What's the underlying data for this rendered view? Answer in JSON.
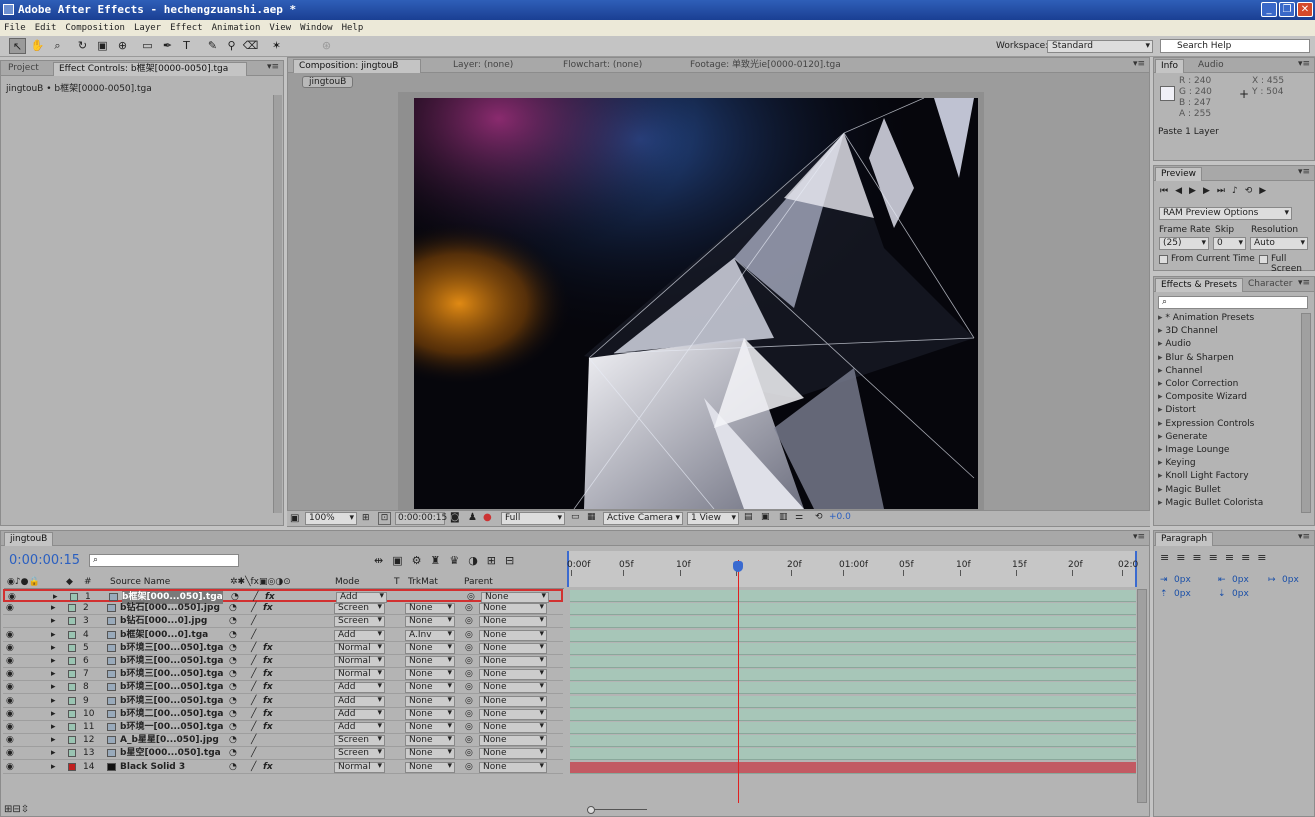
{
  "window": {
    "title": "Adobe After Effects - hechengzuanshi.aep *",
    "min": "_",
    "max": "❐",
    "close": "✕"
  },
  "menu": [
    "File",
    "Edit",
    "Composition",
    "Layer",
    "Effect",
    "Animation",
    "View",
    "Window",
    "Help"
  ],
  "workspace": {
    "label": "Workspace:",
    "value": "Standard"
  },
  "help": {
    "placeholder": "Search Help"
  },
  "left_panel": {
    "tabs": [
      "Project",
      "Effect Controls: b框架[0000-0050].tga"
    ],
    "breadcrumb": "jingtouB • b框架[0000-0050].tga"
  },
  "comp_panel": {
    "tabs": [
      "Composition: jingtouB",
      "Layer: (none)",
      "Flowchart: (none)",
      "Footage: 单致光ie[0000-0120].tga"
    ],
    "comp_button": "jingtouB",
    "footer": {
      "zoom": "100%",
      "timecode": "0:00:00:15",
      "resolution": "Full",
      "camera": "Active Camera",
      "views": "1 View",
      "exposure": "+0.0"
    }
  },
  "info": {
    "tabs": [
      "Info",
      "Audio"
    ],
    "r": "R : 240",
    "g": "G : 240",
    "b": "B : 247",
    "a": "A : 255",
    "x": "X : 455",
    "y": "Y : 504",
    "status": "Paste 1 Layer"
  },
  "preview": {
    "tab": "Preview",
    "ram": "RAM Preview Options",
    "frame_rate_label": "Frame Rate",
    "skip_label": "Skip",
    "resolution_label": "Resolution",
    "frame_rate": "(25)",
    "skip": "0",
    "resolution": "Auto",
    "from_current": "From Current Time",
    "full_screen": "Full Screen"
  },
  "effects": {
    "tabs": [
      "Effects & Presets",
      "Character"
    ],
    "items": [
      "* Animation Presets",
      "3D Channel",
      "Audio",
      "Blur & Sharpen",
      "Channel",
      "Color Correction",
      "Composite Wizard",
      "Distort",
      "Expression Controls",
      "Generate",
      "Image Lounge",
      "Keying",
      "Knoll Light Factory",
      "Magic Bullet",
      "Magic Bullet Colorista"
    ]
  },
  "paragraph": {
    "tab": "Paragraph",
    "indent1": "0px",
    "indent2": "0px",
    "indent3": "0px",
    "space1": "0px",
    "space2": "0px"
  },
  "timeline": {
    "tab": "jingtouB",
    "timecode": "0:00:00:15",
    "ruler": [
      "0:00f",
      "05f",
      "10f",
      "",
      "20f",
      "01:00f",
      "05f",
      "10f",
      "15f",
      "20f",
      "02:0"
    ],
    "headers": {
      "num": "#",
      "source": "Source Name",
      "mode": "Mode",
      "t": "T",
      "trkmat": "TrkMat",
      "parent": "Parent"
    },
    "layers": [
      {
        "num": "1",
        "name": "b框架[000...050].tga",
        "mode": "Add",
        "trkmat": "",
        "parent": "None",
        "fx": true
      },
      {
        "num": "2",
        "name": "b钻石[000...050].jpg",
        "mode": "Screen",
        "trkmat": "None",
        "parent": "None",
        "fx": true
      },
      {
        "num": "3",
        "name": "b钻石[000...0].jpg",
        "mode": "Screen",
        "trkmat": "None",
        "parent": "None",
        "fx": false
      },
      {
        "num": "4",
        "name": "b框架[000...0].tga",
        "mode": "Add",
        "trkmat": "A.Inv",
        "parent": "None",
        "fx": false
      },
      {
        "num": "5",
        "name": "b环境三[00...050].tga",
        "mode": "Normal",
        "trkmat": "None",
        "parent": "None",
        "fx": true
      },
      {
        "num": "6",
        "name": "b环境三[00...050].tga",
        "mode": "Normal",
        "trkmat": "None",
        "parent": "None",
        "fx": true
      },
      {
        "num": "7",
        "name": "b环境三[00...050].tga",
        "mode": "Normal",
        "trkmat": "None",
        "parent": "None",
        "fx": true
      },
      {
        "num": "8",
        "name": "b环境三[00...050].tga",
        "mode": "Add",
        "trkmat": "None",
        "parent": "None",
        "fx": true
      },
      {
        "num": "9",
        "name": "b环境三[00...050].tga",
        "mode": "Add",
        "trkmat": "None",
        "parent": "None",
        "fx": true
      },
      {
        "num": "10",
        "name": "b环境二[00...050].tga",
        "mode": "Add",
        "trkmat": "None",
        "parent": "None",
        "fx": true
      },
      {
        "num": "11",
        "name": "b环境一[00...050].tga",
        "mode": "Add",
        "trkmat": "None",
        "parent": "None",
        "fx": true
      },
      {
        "num": "12",
        "name": "A_b星星[0...050].jpg",
        "mode": "Screen",
        "trkmat": "None",
        "parent": "None",
        "fx": false
      },
      {
        "num": "13",
        "name": "b星空[000...050].tga",
        "mode": "Screen",
        "trkmat": "None",
        "parent": "None",
        "fx": false
      },
      {
        "num": "14",
        "name": "Black Solid 3",
        "mode": "Normal",
        "trkmat": "None",
        "parent": "None",
        "fx": true
      }
    ]
  },
  "colors": {
    "selection": "#d23030",
    "layer_bar": "#a7c6b8",
    "solid_bar": "#c25a63",
    "timecode": "#2a5fc0"
  }
}
